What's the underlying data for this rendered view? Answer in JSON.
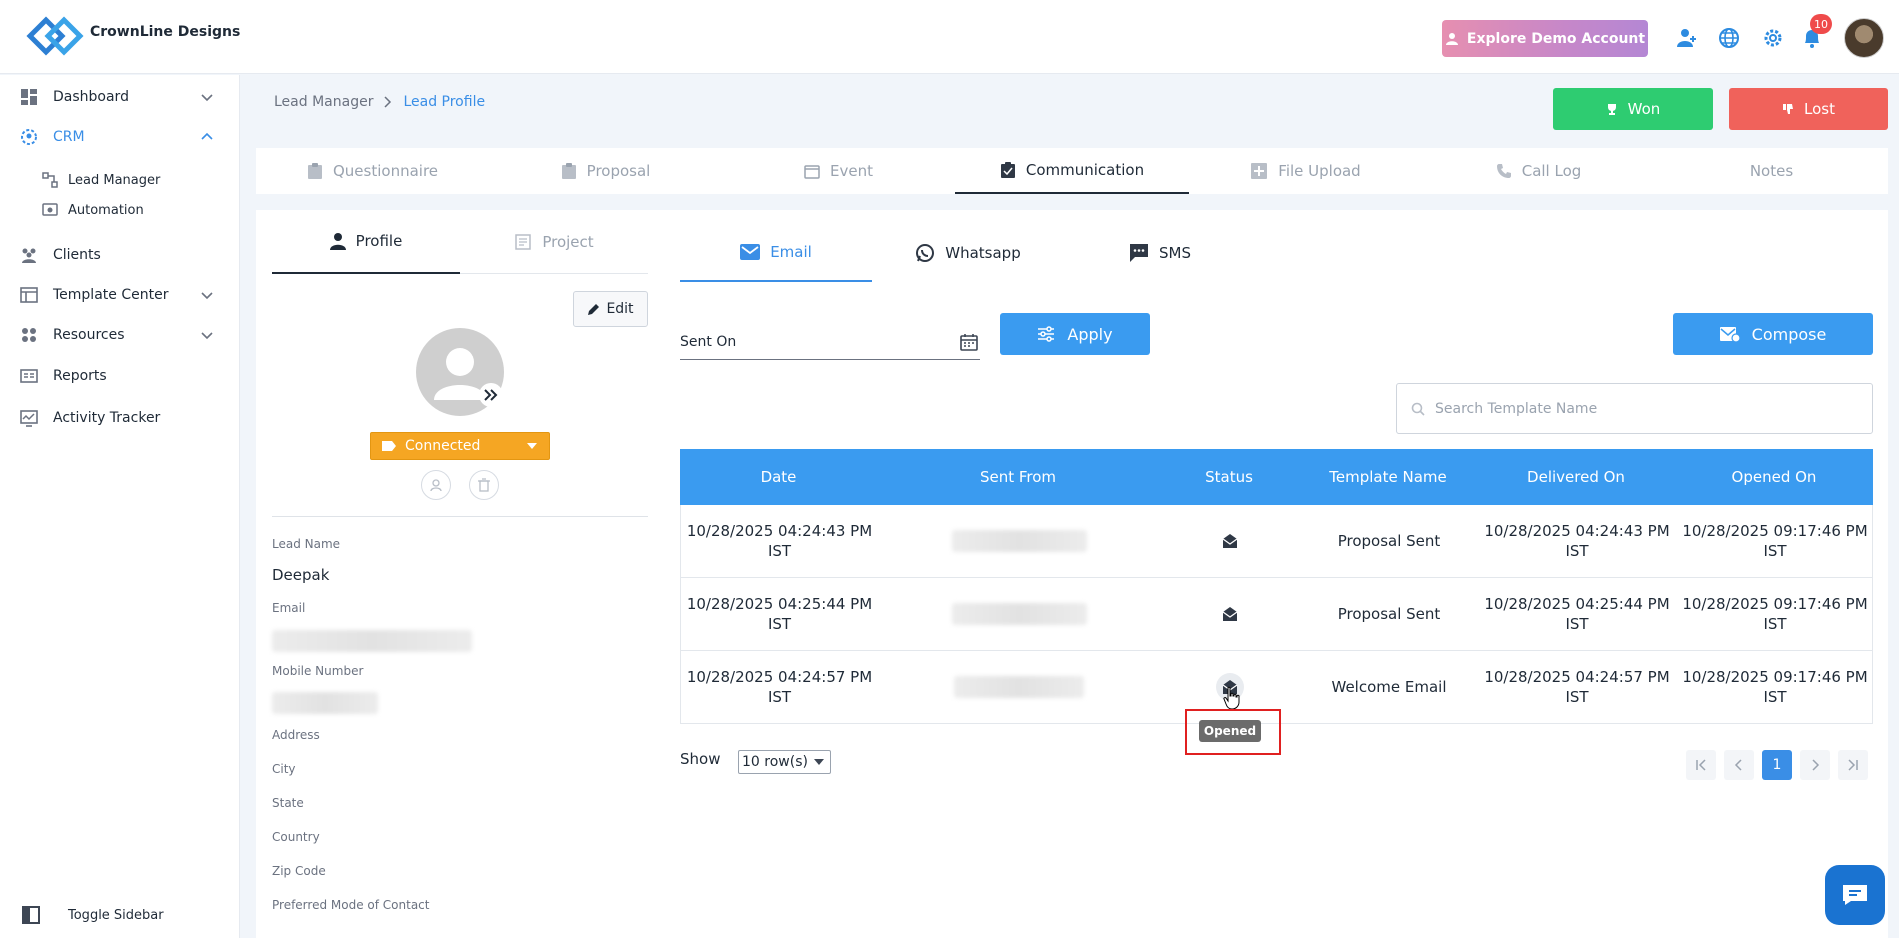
{
  "header": {
    "brand": "CrownLine Designs",
    "demo_button": "Explore Demo Account",
    "notification_count": "10"
  },
  "sidebar": {
    "items": [
      {
        "label": "Dashboard",
        "icon": "dashboard-icon"
      },
      {
        "label": "CRM",
        "icon": "crm-icon"
      },
      {
        "label": "Lead Manager",
        "icon": "lead-manager-icon"
      },
      {
        "label": "Automation",
        "icon": "automation-icon"
      },
      {
        "label": "Clients",
        "icon": "clients-icon"
      },
      {
        "label": "Template Center",
        "icon": "template-icon"
      },
      {
        "label": "Resources",
        "icon": "resources-icon"
      },
      {
        "label": "Reports",
        "icon": "reports-icon"
      },
      {
        "label": "Activity Tracker",
        "icon": "activity-icon"
      }
    ],
    "toggle_label": "Toggle Sidebar"
  },
  "breadcrumb": {
    "parent": "Lead Manager",
    "current": "Lead Profile"
  },
  "actions": {
    "won": "Won",
    "lost": "Lost"
  },
  "main_tabs": [
    "Questionnaire",
    "Proposal",
    "Event",
    "Communication",
    "File Upload",
    "Call Log",
    "Notes"
  ],
  "profile": {
    "tabs": [
      "Profile",
      "Project"
    ],
    "edit": "Edit",
    "status": "Connected",
    "fields": {
      "lead_name_label": "Lead Name",
      "lead_name": "Deepak",
      "email_label": "Email",
      "mobile_label": "Mobile Number",
      "address_label": "Address",
      "city_label": "City",
      "state_label": "State",
      "country_label": "Country",
      "zip_label": "Zip Code",
      "contact_mode_label": "Preferred Mode of Contact"
    }
  },
  "communication": {
    "tabs": [
      "Email",
      "Whatsapp",
      "SMS"
    ],
    "sent_on_label": "Sent On",
    "apply": "Apply",
    "compose": "Compose",
    "search_placeholder": "Search Template Name",
    "columns": [
      "Date",
      "Sent From",
      "Status",
      "Template Name",
      "Delivered On",
      "Opened On"
    ],
    "rows": [
      {
        "date": "10/28/2025 04:24:43 PM IST",
        "template": "Proposal Sent",
        "delivered": "10/28/2025 04:24:43 PM IST",
        "opened": "10/28/2025 09:17:46 PM IST"
      },
      {
        "date": "10/28/2025 04:25:44 PM IST",
        "template": "Proposal Sent",
        "delivered": "10/28/2025 04:25:44 PM IST",
        "opened": "10/28/2025 09:17:46 PM IST"
      },
      {
        "date": "10/28/2025 04:24:57 PM IST",
        "template": "Welcome Email",
        "delivered": "10/28/2025 04:24:57 PM IST",
        "opened": "10/28/2025 09:17:46 PM IST"
      }
    ],
    "tooltip": "Opened",
    "show_label": "Show",
    "rows_per_page": "10 row(s)",
    "current_page": "1"
  },
  "colors": {
    "primary": "#3a9bf0",
    "won": "#2ecc71",
    "lost": "#f0625b",
    "connected": "#f5a623"
  }
}
